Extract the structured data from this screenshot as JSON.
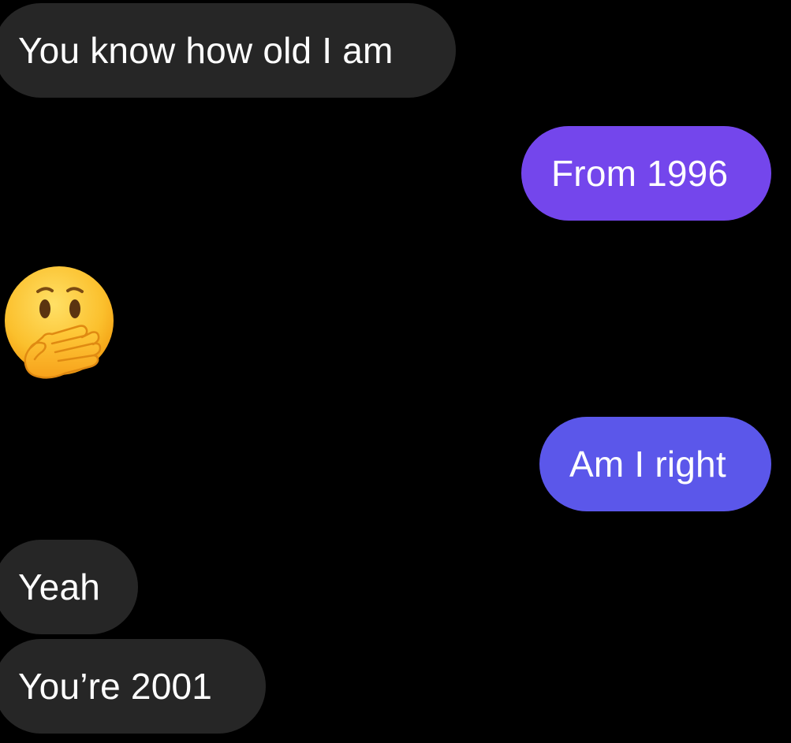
{
  "colors": {
    "background": "#000000",
    "received_bubble": "#262626",
    "sent_bubble_top": "#7446ec",
    "sent_bubble_bottom": "#5b57ea",
    "text": "#ffffff"
  },
  "messages": [
    {
      "direction": "received",
      "text": "You know how old I am"
    },
    {
      "direction": "sent",
      "text": "From 1996"
    },
    {
      "direction": "received",
      "type": "emoji",
      "icon": "face-with-hand-over-mouth-icon"
    },
    {
      "direction": "sent",
      "text": "Am I right"
    },
    {
      "direction": "received",
      "text": "Yeah"
    },
    {
      "direction": "received",
      "text": "You’re 2001"
    }
  ]
}
